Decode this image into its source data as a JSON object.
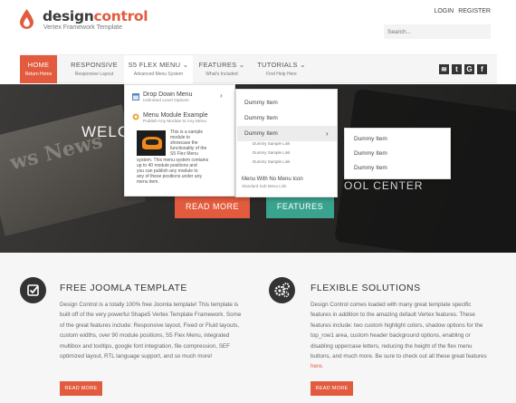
{
  "header": {
    "brand_part1": "design",
    "brand_part2": "control",
    "tagline": "Vertex Framework Template",
    "login": "LOGIN",
    "register": "REGISTER",
    "search_placeholder": "Search..."
  },
  "nav": {
    "items": [
      {
        "label": "HOME",
        "sub": "Return Home"
      },
      {
        "label": "RESPONSIVE",
        "sub": "Responsive Layout"
      },
      {
        "label": "S5 FLEX MENU",
        "sub": "Advanced Menu System"
      },
      {
        "label": "FEATURES",
        "sub": "What's Included"
      },
      {
        "label": "TUTORIALS",
        "sub": "Find Help Here"
      }
    ],
    "social": [
      "rss-icon",
      "twitter-icon",
      "google-icon",
      "facebook-icon"
    ]
  },
  "dropdown1": {
    "item1_title": "Drop Down Menu",
    "item1_sub": "Unlimited Level Options",
    "item2_title": "Menu Module Example",
    "item2_sub": "Publish Any Module to Any Menu",
    "module_text_lines": [
      "This is a sample",
      "module to",
      "showcase the",
      "functionality of the",
      "S5 Flex Menu",
      "system. This menu system contains",
      "up to 40 module positions and",
      "you can publish any module to",
      "any of these positions under any",
      "menu item."
    ]
  },
  "dropdown2": {
    "items": [
      "Dummy Item",
      "Dummy Item",
      "Dummy Item"
    ],
    "small_links": [
      "Dummy Sample Link",
      "Dummy Sample Link",
      "Dummy Sample Link"
    ],
    "bottom_title": "Menu With No Menu Icon",
    "bottom_sub": "Standard Sub Menu Link"
  },
  "dropdown3": {
    "items": [
      "Dummy Item",
      "Dummy Item",
      "Dummy Item"
    ]
  },
  "hero": {
    "title_left": "WELC",
    "title_right": "OOL CENTER",
    "paper_text": "ws News",
    "btn_readmore": "READ MORE",
    "btn_features": "FEATURES"
  },
  "features": [
    {
      "title": "FREE JOOMLA TEMPLATE",
      "text": "Design Control is a totally 100% free Joomla template! This template is built off of the very powerful Shape5 Vertex Template Framework. Some of the great features include: Responsive layout, Fixed or Fluid layouts, custom widths, over 90 module positions, S5 Flex Menu, integrated multibox and tooltips, google font integration, file compression, SEF optimized layout, RTL language support, and so much more!",
      "button": "READ MORE"
    },
    {
      "title": "FLEXIBLE SOLUTIONS",
      "text": "Design Control comes loaded with many great template specific features in addition to the amazing default Vertex features. These features include: two custom highlight colors, shadow options for the top_row1 area, custom header background options, enabling or disabling uppercase letters, reducing the height of the flex menu buttons, and much more. Be sure to check out all these great features",
      "link": "here",
      "button": "READ MORE"
    }
  ],
  "colors": {
    "accent": "#e35b3e",
    "teal": "#3aa38d",
    "dark": "#333333"
  }
}
